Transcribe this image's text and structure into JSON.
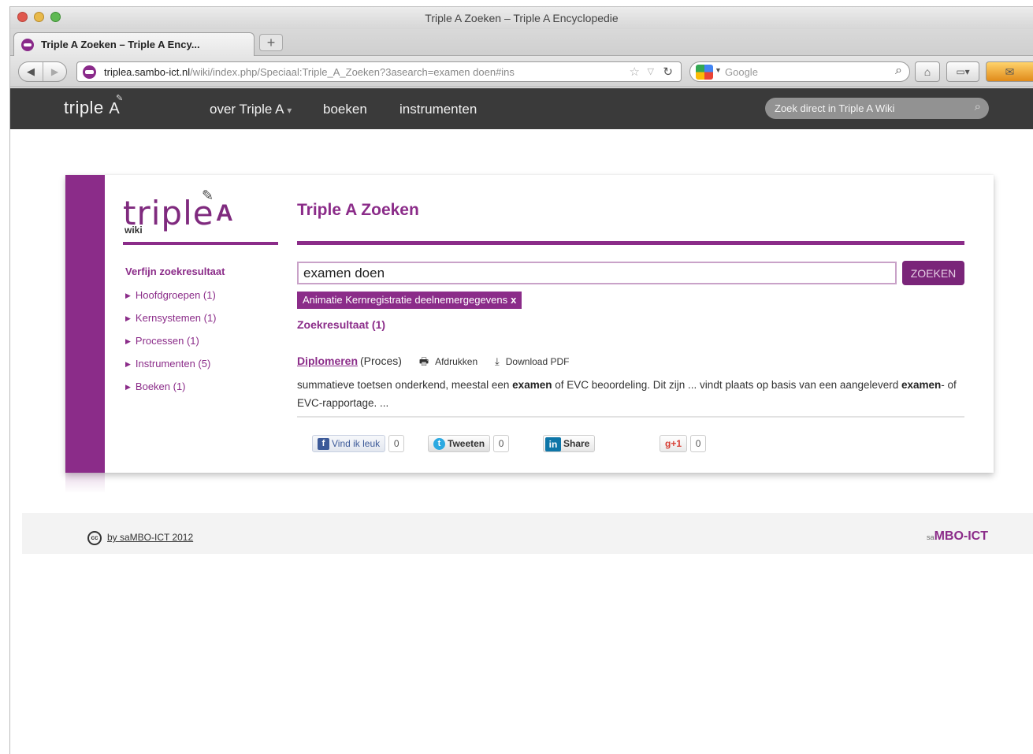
{
  "browser": {
    "window_title": "Triple A Zoeken – Triple A Encyclopedie",
    "tab_label": "Triple A Zoeken – Triple A Ency...",
    "new_tab": "+",
    "url_domain": "triplea.sambo-ict.nl",
    "url_rest": "/wiki/index.php/Speciaal:Triple_A_Zoeken?3asearch=examen doen#ins",
    "search_placeholder": "Google",
    "icons": [
      "back-icon",
      "forward-icon",
      "star-icon",
      "reload-icon",
      "search-icon",
      "home-icon",
      "view-icon"
    ]
  },
  "site_header": {
    "logo": "triple",
    "logo_a": "A",
    "nav": {
      "over": "over Triple A",
      "boeken": "boeken",
      "instrumenten": "instrumenten"
    },
    "search_placeholder": "Zoek direct in Triple A Wiki"
  },
  "sidebar": {
    "logo_word": "triple",
    "logo_a": "A",
    "logo_sub": "wiki",
    "refine_title": "Verfijn zoekresultaat",
    "items": [
      {
        "label": "Hoofdgroepen (1)"
      },
      {
        "label": "Kernsystemen (1)"
      },
      {
        "label": "Processen (1)"
      },
      {
        "label": "Instrumenten (5)"
      },
      {
        "label": "Boeken (1)"
      }
    ]
  },
  "main": {
    "title": "Triple A Zoeken",
    "query_value": "examen doen",
    "search_button": "ZOEKEN",
    "filter_tag": "Animatie Kernregistratie deelnemergegevens",
    "filter_tag_remove": "x",
    "results_count": "Zoekresultaat (1)",
    "result": {
      "title": "Diplomeren",
      "type": "(Proces)",
      "print_label": "Afdrukken",
      "pdf_label": "Download PDF",
      "snippet_1": "summatieve toetsen onderkend, meestal een ",
      "snippet_bold_1": "examen",
      "snippet_2": " of EVC beoordeling. Dit zijn ... vindt plaats op basis van een aangeleverd ",
      "snippet_bold_2": "examen",
      "snippet_3": "- of EVC-rapportage. ..."
    },
    "social": {
      "like_label": "Vind ik leuk",
      "like_count": "0",
      "tweet_label": "Tweeten",
      "tweet_count": "0",
      "share_label": "Share",
      "gplus_label": "+1",
      "gplus_count": "0"
    }
  },
  "footer": {
    "copyright": "by saMBO-ICT 2012",
    "brand_prefix": "sa",
    "brand": "MBO-ICT"
  },
  "colors": {
    "brand_purple": "#8b2c89",
    "header_dark": "#3a3a3a",
    "footer_bg": "#f3f3f3"
  }
}
